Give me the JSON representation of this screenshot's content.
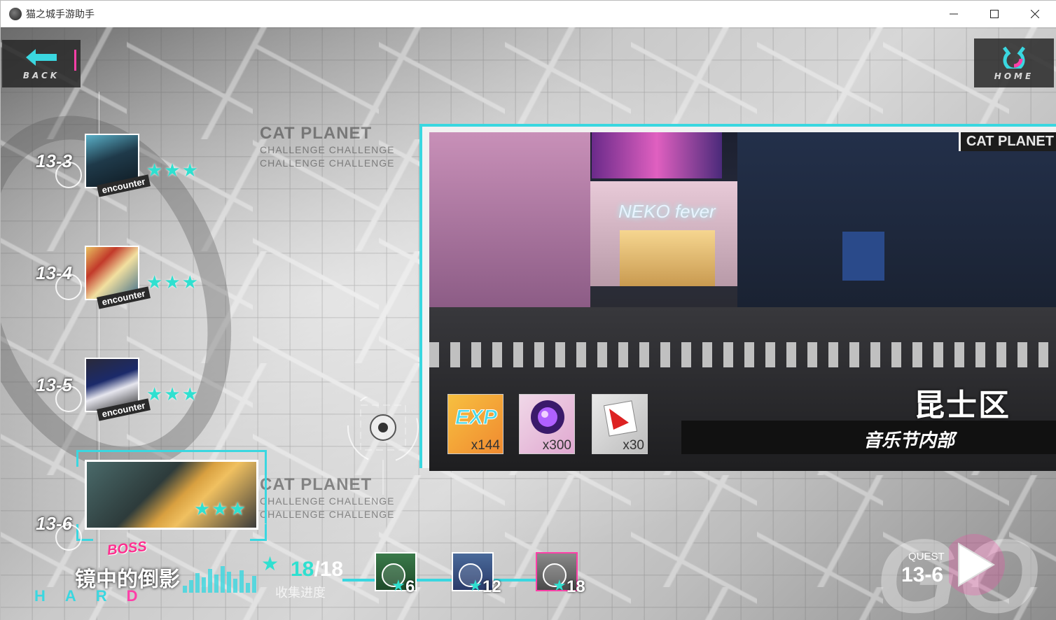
{
  "window": {
    "title": "猫之城手游助手",
    "minimize_icon": "minimize-icon",
    "maximize_icon": "maximize-icon",
    "close_icon": "close-icon"
  },
  "nav": {
    "back_label": "BACK",
    "home_label": "HOME"
  },
  "watermark": {
    "title": "CAT PLANET",
    "line1": "CHALLENGE  CHALLENGE",
    "line2": "CHALLENGE  CHALLENGE"
  },
  "stages": [
    {
      "number": "13-3",
      "tag": "encounter",
      "stars": 3
    },
    {
      "number": "13-4",
      "tag": "encounter",
      "stars": 3
    },
    {
      "number": "13-5",
      "tag": "encounter",
      "stars": 3
    },
    {
      "number": "13-6",
      "tag": "BOSS",
      "stars": 3,
      "selected": true
    }
  ],
  "preview": {
    "location_tag": "CAT PLANET",
    "shop_sign": "NEKO fever",
    "district": "昆士区",
    "subtitle": "音乐节内部",
    "rewards": [
      {
        "name": "EXP",
        "qty": "x144"
      },
      {
        "name": "crystal",
        "qty": "x300"
      },
      {
        "name": "card",
        "qty": "x30"
      }
    ]
  },
  "bottom": {
    "difficulty_letters": [
      "H",
      "A",
      "R",
      "D"
    ],
    "stage_name": "镜中的倒影",
    "progress_current": "18",
    "progress_total": "/18",
    "progress_label": "收集进度",
    "chests": [
      {
        "threshold": "6",
        "claimed": true
      },
      {
        "threshold": "12",
        "claimed": true
      },
      {
        "threshold": "18",
        "claimed": true
      }
    ],
    "quest_label": "QUEST",
    "quest_number": "13-6",
    "go_text": "GO"
  },
  "colors": {
    "accent_cyan": "#3ad7e0",
    "accent_pink": "#ff3fa8"
  }
}
